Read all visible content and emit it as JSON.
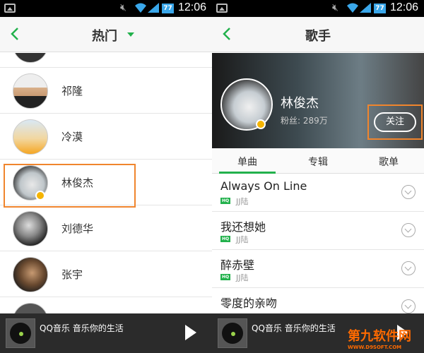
{
  "status_bar": {
    "time": "12:06",
    "battery": "77"
  },
  "left_screen": {
    "header": {
      "title": "热门"
    },
    "singers": [
      {
        "name": ""
      },
      {
        "name": "祁隆"
      },
      {
        "name": "冷漠"
      },
      {
        "name": "林俊杰"
      },
      {
        "name": "刘德华"
      },
      {
        "name": "张宇"
      },
      {
        "name": ""
      }
    ],
    "player": {
      "text": "QQ音乐 音乐你的生活"
    }
  },
  "right_screen": {
    "header": {
      "title": "歌手"
    },
    "singer": {
      "name": "林俊杰",
      "fans": "粉丝: 289万",
      "follow_label": "关注"
    },
    "tabs": [
      "单曲",
      "专辑",
      "歌单"
    ],
    "songs": [
      {
        "title": "Always On Line",
        "artist": "JJ陆",
        "badge": "HQ"
      },
      {
        "title": "我还想她",
        "artist": "JJ陆",
        "badge": "HQ"
      },
      {
        "title": "醉赤壁",
        "artist": "JJ陆",
        "badge": "HQ"
      },
      {
        "title": "零度的亲吻",
        "artist": "",
        "badge": ""
      }
    ],
    "player": {
      "text": "QQ音乐 音乐你的生活"
    }
  },
  "watermark": {
    "main": "第九软件网",
    "sub": "WWW.D9SOFT.COM"
  },
  "colors": {
    "accent": "#22b14c",
    "highlight": "#f0852d",
    "player_bg": "#2b2b2b"
  }
}
